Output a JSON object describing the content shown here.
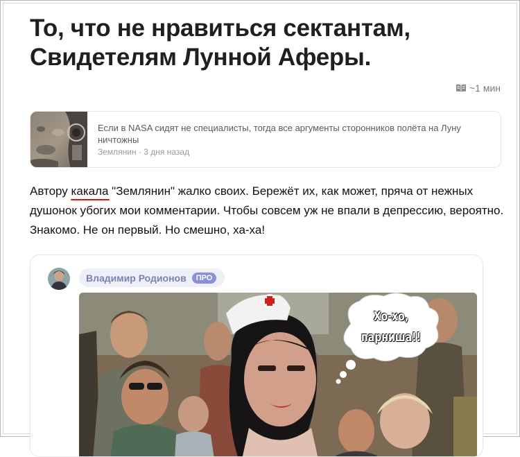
{
  "article": {
    "title": "То, что не нравиться сектантам, Свидетелям Лунной Аферы.",
    "read_time": "~1 мин",
    "read_time_icon": "book-open-icon"
  },
  "repost": {
    "title": "Если в NASA сидят не специалисты, тогда все аргументы сторонников полёта на Луну ничтожны",
    "meta": "Землянин · 3 дня назад"
  },
  "body": {
    "prefix": "Автору ",
    "underlined_word": "какала",
    "rest": " \"Землянин\" жалко своих. Бережёт их, как может, пряча от нежных душонок убогих мои комментарии. Чтобы совсем уж не впали в депрессию, вероятно. Знакомо. Не он первый. Но смешно, ха-ха!",
    "underline_color": "#e01010"
  },
  "embed": {
    "author": "Владимир Родионов",
    "badge": "ПРО",
    "speech_bubble": {
      "line1": "Хо-хо,",
      "line2": "парниша!!"
    }
  },
  "colors": {
    "title": "#1f1f1f",
    "author_chip_bg": "#eef0f7",
    "author_name": "#7a7fb5",
    "pro_badge": "#8a8fd8"
  }
}
